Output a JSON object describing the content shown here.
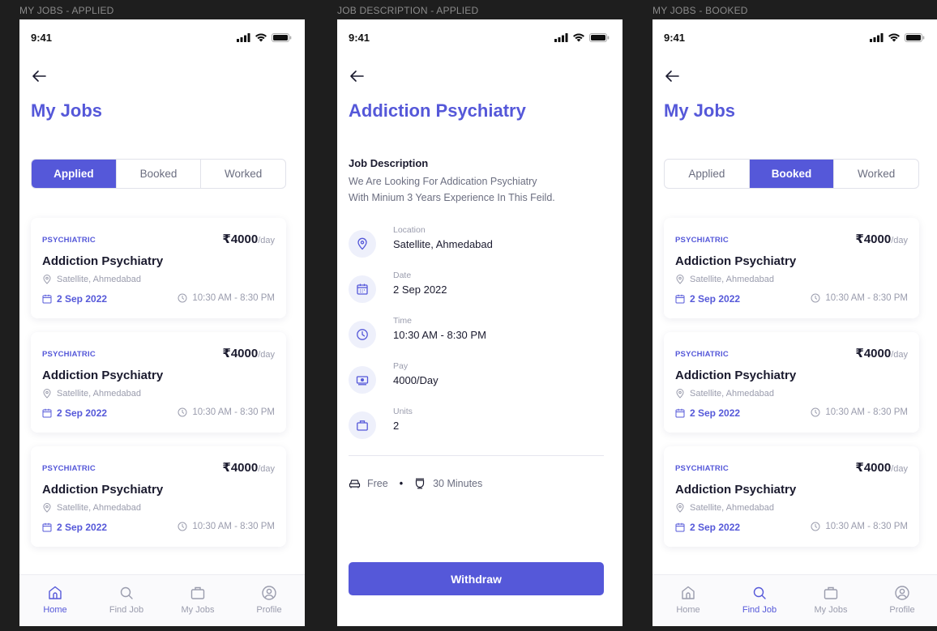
{
  "screens": {
    "applied": {
      "label": "MY JOBS - APPLIED",
      "time": "9:41",
      "title": "My Jobs",
      "tabs": [
        "Applied",
        "Booked",
        "Worked"
      ],
      "active_tab": "Applied"
    },
    "description": {
      "label": "JOB DESCRIPTION - APPLIED",
      "time": "9:41",
      "title": "Addiction Psychiatry",
      "jd_heading": "Job Description",
      "jd_text_line1": "We Are Looking For  Addication Psychiatry",
      "jd_text_line2": "With Minium 3 Years Experience In This Feild.",
      "info": [
        {
          "label": "Location",
          "value": "Satellite, Ahmedabad",
          "icon": "location-pin-icon"
        },
        {
          "label": "Date",
          "value": "2 Sep 2022",
          "icon": "calendar-icon"
        },
        {
          "label": "Time",
          "value": "10:30 AM - 8:30 PM",
          "icon": "clock-icon"
        },
        {
          "label": "Pay",
          "value": "4000/Day",
          "icon": "cash-icon"
        },
        {
          "label": "Units",
          "value": "2",
          "icon": "briefcase-icon"
        }
      ],
      "parking": "Free",
      "break": "30 Minutes",
      "withdraw_label": "Withdraw"
    },
    "booked": {
      "label": "MY JOBS - BOOKED",
      "time": "9:41",
      "title": "My Jobs",
      "tabs": [
        "Applied",
        "Booked",
        "Worked"
      ],
      "active_tab": "Booked"
    }
  },
  "job_card": {
    "category": "PSYCHIATRIC",
    "price": "₹4000",
    "per": "/day",
    "title": "Addiction Psychiatry",
    "location": "Satellite, Ahmedabad",
    "date": "2 Sep 2022",
    "hours": "10:30 AM - 8:30 PM"
  },
  "nav": [
    "Home",
    "Find Job",
    "My Jobs",
    "Profile"
  ],
  "colors": {
    "accent": "#5558d9",
    "muted": "#9a9cad",
    "text": "#1a1a2e",
    "background": "#1e1e1e"
  }
}
